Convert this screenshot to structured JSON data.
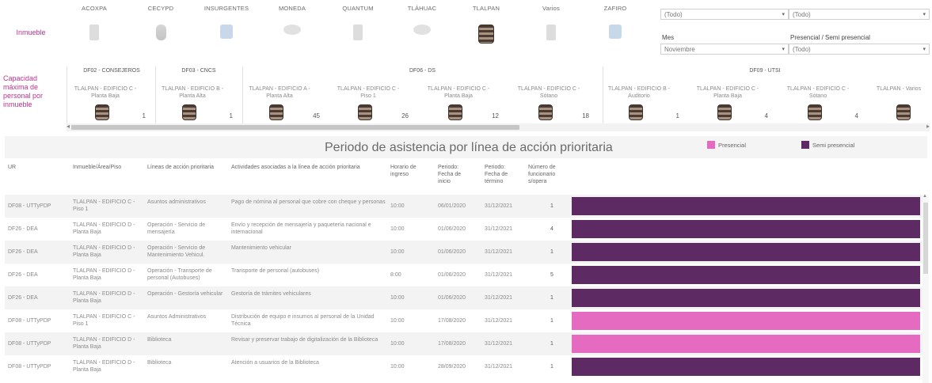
{
  "inmueble_label": "Inmueble",
  "buildings": [
    {
      "name": "ACOXPA",
      "icon": "box-building-icon"
    },
    {
      "name": "CECYPD",
      "icon": "cylinder-building-icon"
    },
    {
      "name": "INSURGENTES",
      "icon": "blue-building-icon"
    },
    {
      "name": "MONEDA",
      "icon": "oval-building-icon"
    },
    {
      "name": "QUANTUM",
      "icon": "box-building-icon"
    },
    {
      "name": "TLÁHUAC",
      "icon": "oval-building-icon"
    },
    {
      "name": "TLALPAN",
      "icon": "stacked-building-icon"
    },
    {
      "name": "Varios",
      "icon": "box-building-icon"
    },
    {
      "name": "ZAFIRO",
      "icon": "blue-building-icon"
    }
  ],
  "filters": {
    "top_left_value": "(Todo)",
    "top_right_value": "(Todo)",
    "mes_label": "Mes",
    "mes_value": "Noviembre",
    "presencial_label": "Presencial / Semi presencial",
    "presencial_value": "(Todo)"
  },
  "capacity": {
    "label": "Capacidad máxima de personal por inmueble",
    "groups": [
      "DF02 - CONSEJEROS",
      "DF03 - CNCS",
      "DF06 - DS",
      "DF09 - UTSI"
    ],
    "columns": [
      {
        "name": "TLALPAN - EDIFICIO C - Planta Baja",
        "value": "1"
      },
      {
        "name": "TLALPAN - EDIFICIO B - Planta Alta",
        "value": "1"
      },
      {
        "name": "TLALPAN - EDIFICIO A - Planta Alta",
        "value": "45"
      },
      {
        "name": "TLALPAN - EDIFICIO C - Piso 1",
        "value": "26"
      },
      {
        "name": "TLALPAN - EDIFICIO C - Planta Baja",
        "value": "12"
      },
      {
        "name": "TLALPAN - EDIFICIO C - Sótano",
        "value": "18"
      },
      {
        "name": "TLALPAN - EDIFICIO B - Auditorio",
        "value": "1"
      },
      {
        "name": "TLALPAN - EDIFICIO C - Planta Baja",
        "value": "4"
      },
      {
        "name": "TLALPAN - EDIFICIO C - Sótano",
        "value": "4"
      },
      {
        "name": "TLALPAN - Varios",
        "value": ""
      }
    ]
  },
  "chart_title": "Periodo de asistencia por línea de acción prioritaria",
  "legend": {
    "presencial": "Presencial",
    "semi": "Semi presencial"
  },
  "colors": {
    "presencial": "#e46bbf",
    "semi": "#5e2a63",
    "accent": "#c0328f"
  },
  "table": {
    "headers": {
      "ur": "UR",
      "inmueble": "Inmueble/Área/Piso",
      "linea": "Líneas de acción prioritaria",
      "actividades": "Actividades asociadas a la línea de acción prioritaria",
      "horario": "Horario de ingreso",
      "fecha_inicio": "Periodo: Fecha de inicio",
      "fecha_termino": "Periodo: Fecha de término",
      "num": "Número de funcionario s/opera"
    },
    "rows": [
      {
        "ur": "DF08 - UTTyPDP",
        "inmueble": "TLALPAN - EDIFICIO C - Piso 1",
        "linea": "Asuntos administrativos",
        "actividades": "Pago de nómina al personal que cobre con cheque y personas",
        "horario": "10:00",
        "inicio": "06/01/2020",
        "termino": "31/12/2021",
        "num": "1",
        "mode": "semi"
      },
      {
        "ur": "DF26 - DEA",
        "inmueble": "TLALPAN - EDIFICIO D - Planta Baja",
        "linea": "Operación - Servicio de mensajería",
        "actividades": "Envío y recepción de mensajería y paquetería nacional e internacional",
        "horario": "10:00",
        "inicio": "01/06/2020",
        "termino": "31/12/2021",
        "num": "4",
        "mode": "semi"
      },
      {
        "ur": "DF26 - DEA",
        "inmueble": "TLALPAN - EDIFICIO D - Planta Baja",
        "linea": "Operación - Servicio de Mantenimiento Vehicul.",
        "actividades": "Mantenimiento vehicular",
        "horario": "10:00",
        "inicio": "01/06/2020",
        "termino": "31/12/2021",
        "num": "1",
        "mode": "semi"
      },
      {
        "ur": "DF26 - DEA",
        "inmueble": "TLALPAN - EDIFICIO D - Planta Baja",
        "linea": "Operación - Transporte de personal (Autobuses)",
        "actividades": "Transporte de personal (autobuses)",
        "horario": "8:00",
        "inicio": "01/06/2020",
        "termino": "31/12/2021",
        "num": "5",
        "mode": "semi"
      },
      {
        "ur": "DF26 - DEA",
        "inmueble": "TLALPAN - EDIFICIO D - Planta Baja",
        "linea": "Operación - Gestoría vehicular",
        "actividades": "Gestoría de trámites vehiculares",
        "horario": "10:00",
        "inicio": "01/06/2020",
        "termino": "31/12/2021",
        "num": "1",
        "mode": "semi"
      },
      {
        "ur": "DF08 - UTTyPDP",
        "inmueble": "TLALPAN - EDIFICIO C - Piso 1",
        "linea": "Asuntos Administrativos",
        "actividades": "Distribución de equipo e insumos al personal de la Unidad Técnica",
        "horario": "10:00",
        "inicio": "17/08/2020",
        "termino": "31/12/2021",
        "num": "1",
        "mode": "presencial"
      },
      {
        "ur": "DF08 - UTTyPDP",
        "inmueble": "TLALPAN - EDIFICIO D - Planta Baja",
        "linea": "Biblioteca",
        "actividades": "Revisar y preservar trabajo de digitalización de la Biblioteca",
        "horario": "10:00",
        "inicio": "17/08/2020",
        "termino": "31/12/2021",
        "num": "1",
        "mode": "presencial"
      },
      {
        "ur": "DF08 - UTTyPDP",
        "inmueble": "TLALPAN - EDIFICIO D - Planta Baja",
        "linea": "Biblioteca",
        "actividades": "Atención a usuarios de la Biblioteca",
        "horario": "10:00",
        "inicio": "28/09/2020",
        "termino": "31/12/2021",
        "num": "1",
        "mode": "semi"
      }
    ]
  }
}
